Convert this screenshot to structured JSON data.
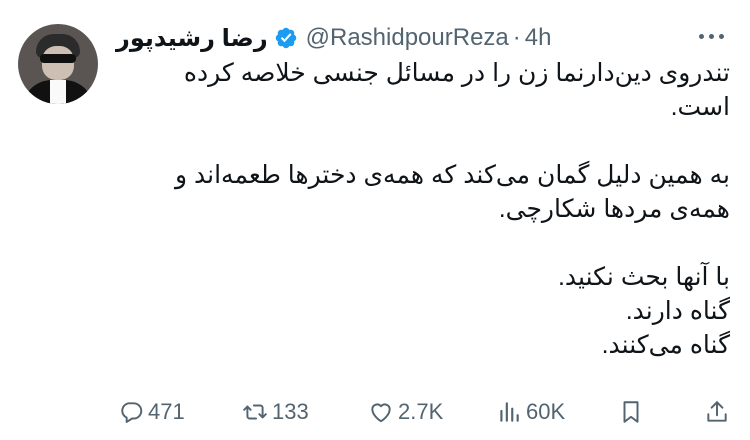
{
  "author": {
    "name": "رضا رشیدپور",
    "handle": "@RashidpourReza",
    "separator": "·",
    "time": "4h"
  },
  "tweet": {
    "paragraphs": [
      "تندروی دین‌دارنما زن را در مسائل جنسی خلاصه کرده است.",
      "به همین دلیل گمان می‌کند که همه‌ی دخترها طعمه‌اند و همه‌ی مردها شکارچی.",
      "با آنها بحث نکنید.\nگناه دارند.\nگناه می‌کنند."
    ]
  },
  "actions": {
    "replies": "471",
    "retweets": "133",
    "likes": "2.7K",
    "views": "60K"
  },
  "icons": {
    "verified": "verified-badge-icon",
    "more": "more-icon",
    "reply": "reply-icon",
    "retweet": "retweet-icon",
    "like": "heart-icon",
    "views": "views-icon",
    "bookmark": "bookmark-icon",
    "share": "share-icon"
  },
  "colors": {
    "verified": "#1d9bf0",
    "muted": "#536471",
    "text": "#0f1419"
  }
}
